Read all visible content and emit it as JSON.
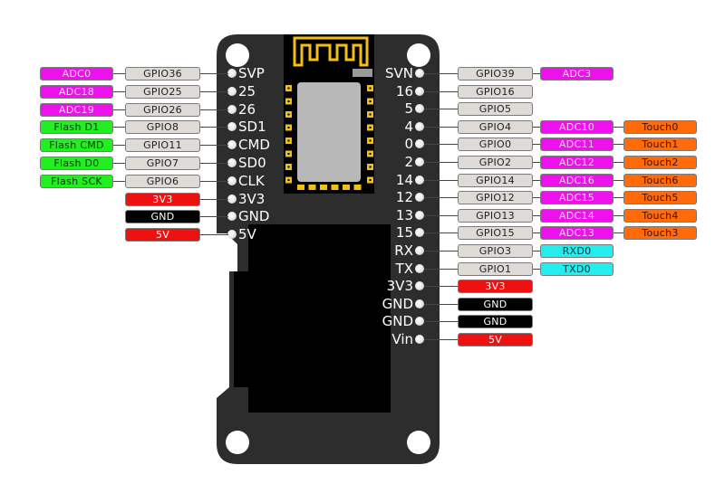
{
  "colors": {
    "board": "#2d2d2d",
    "gpio_bg": "#dedad6",
    "gpio_text": "#222222",
    "adc_bg": "#ee11ee",
    "adc_text": "#ffd6ff",
    "flash_bg": "#22ee22",
    "flash_text": "#0a3a0a",
    "power_red_bg": "#ee1111",
    "power_red_text": "#ffffff",
    "gnd_bg": "#000000",
    "gnd_text": "#ffffff",
    "touch_bg": "#ff6a0a",
    "touch_text": "#3a1400",
    "uart_bg": "#22eeee",
    "uart_text": "#0a3a3a",
    "antenna": "#f2c010",
    "module_shield": "#b8b8b8"
  },
  "board": {
    "name": "ESP32 board with OLED display",
    "left_pins": [
      {
        "pin": "SVP",
        "gpio": "GPIO36",
        "func": "ADC0",
        "func_type": "adc"
      },
      {
        "pin": "25",
        "gpio": "GPIO25",
        "func": "ADC18",
        "func_type": "adc"
      },
      {
        "pin": "26",
        "gpio": "GPIO26",
        "func": "ADC19",
        "func_type": "adc"
      },
      {
        "pin": "SD1",
        "gpio": "GPIO8",
        "func": "Flash D1",
        "func_type": "flash"
      },
      {
        "pin": "CMD",
        "gpio": "GPIO11",
        "func": "Flash CMD",
        "func_type": "flash"
      },
      {
        "pin": "SD0",
        "gpio": "GPIO7",
        "func": "Flash D0",
        "func_type": "flash"
      },
      {
        "pin": "CLK",
        "gpio": "GPIO6",
        "func": "Flash SCK",
        "func_type": "flash"
      },
      {
        "pin": "3V3",
        "power": "3V3",
        "power_type": "red"
      },
      {
        "pin": "GND",
        "power": "GND",
        "power_type": "gnd"
      },
      {
        "pin": "5V",
        "power": "5V",
        "power_type": "red"
      }
    ],
    "right_pins": [
      {
        "pin": "SVN",
        "gpio": "GPIO39",
        "adc": "ADC3"
      },
      {
        "pin": "16",
        "gpio": "GPIO16"
      },
      {
        "pin": "5",
        "gpio": "GPIO5"
      },
      {
        "pin": "4",
        "gpio": "GPIO4",
        "adc": "ADC10",
        "touch": "Touch0"
      },
      {
        "pin": "0",
        "gpio": "GPIO0",
        "adc": "ADC11",
        "touch": "Touch1"
      },
      {
        "pin": "2",
        "gpio": "GPIO2",
        "adc": "ADC12",
        "touch": "Touch2"
      },
      {
        "pin": "14",
        "gpio": "GPIO14",
        "adc": "ADC16",
        "touch": "Touch6"
      },
      {
        "pin": "12",
        "gpio": "GPIO12",
        "adc": "ADC15",
        "touch": "Touch5"
      },
      {
        "pin": "13",
        "gpio": "GPIO13",
        "adc": "ADC14",
        "touch": "Touch4"
      },
      {
        "pin": "15",
        "gpio": "GPIO15",
        "adc": "ADC13",
        "touch": "Touch3"
      },
      {
        "pin": "RX",
        "gpio": "GPIO3",
        "uart": "RXD0"
      },
      {
        "pin": "TX",
        "gpio": "GPIO1",
        "uart": "TXD0"
      },
      {
        "pin": "3V3",
        "power": "3V3",
        "power_type": "red"
      },
      {
        "pin": "GND",
        "power": "GND",
        "power_type": "gnd"
      },
      {
        "pin": "GND",
        "power": "GND",
        "power_type": "gnd"
      },
      {
        "pin": "Vin",
        "power": "5V",
        "power_type": "red"
      }
    ]
  }
}
